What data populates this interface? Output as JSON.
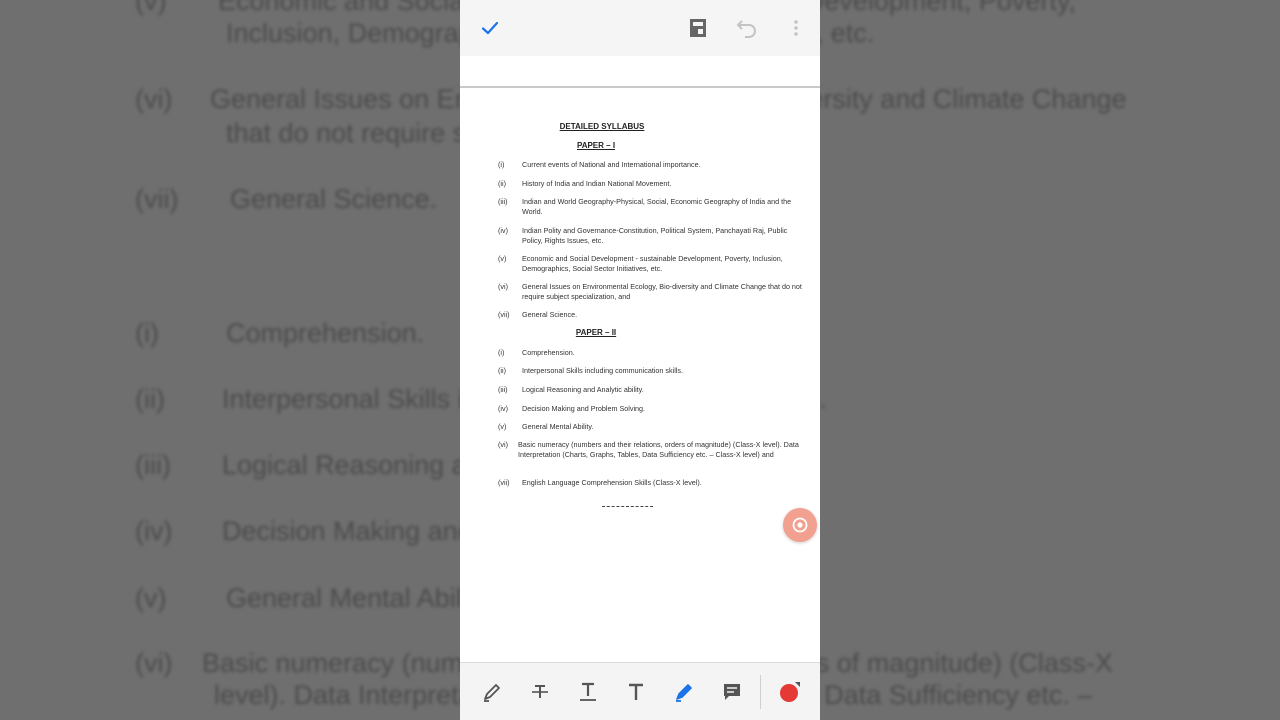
{
  "background_lines": [
    {
      "num": "(v)",
      "text": "Economic and Social Development - sustainable Development, Poverty,"
    },
    {
      "num": "",
      "text": "Inclusion, Demographics, Social Sector Initiatives, etc."
    },
    {
      "num": "(vi)",
      "text": "General Issues on Environmental Ecology, Bio-diversity and Climate Change"
    },
    {
      "num": "",
      "text": "that do not require subject specialization, and"
    },
    {
      "num": "(vii)",
      "text": "General Science."
    },
    {
      "num": "(i)",
      "text": "Comprehension."
    },
    {
      "num": "(ii)",
      "text": "Interpersonal Skills including communication skills."
    },
    {
      "num": "(iii)",
      "text": "Logical Reasoning and Analytic ability."
    },
    {
      "num": "(iv)",
      "text": "Decision Making and Problem Solving."
    },
    {
      "num": "(v)",
      "text": "General Mental Ability."
    },
    {
      "num": "(vi)",
      "text": "Basic numeracy (numbers and their relations, orders of magnitude) (Class-X"
    },
    {
      "num": "",
      "text": "level). Data Interpretation (Charts, Graphs, Tables, Data Sufficiency etc. –"
    }
  ],
  "document": {
    "title": "DETAILED SYLLABUS",
    "paper1": {
      "heading": "PAPER – I",
      "items": [
        {
          "num": "(i)",
          "text": "Current events of National and International importance."
        },
        {
          "num": "(ii)",
          "text": "History of India and Indian National Movement."
        },
        {
          "num": "(iii)",
          "text": "Indian and World Geography-Physical, Social, Economic Geography of India and the World."
        },
        {
          "num": "(iv)",
          "text": "Indian Polity and Governance-Constitution, Political System, Panchayati Raj, Public Policy, Rights Issues, etc."
        },
        {
          "num": "(v)",
          "text": "Economic and Social Development - sustainable Development, Poverty, Inclusion, Demographics, Social Sector Initiatives, etc."
        },
        {
          "num": "(vi)",
          "text": "General Issues on Environmental Ecology, Bio-diversity and Climate Change that do not require subject specialization, and"
        },
        {
          "num": "(vii)",
          "text": "General Science."
        }
      ]
    },
    "paper2": {
      "heading": "PAPER – II",
      "items": [
        {
          "num": "(i)",
          "text": "Comprehension."
        },
        {
          "num": "(ii)",
          "text": "Interpersonal Skills including communication skills."
        },
        {
          "num": "(iii)",
          "text": "Logical Reasoning and Analytic ability."
        },
        {
          "num": "(iv)",
          "text": "Decision Making and Problem Solving."
        },
        {
          "num": "(v)",
          "text": "General Mental Ability."
        },
        {
          "num": "(vi)",
          "text": "Basic numeracy (numbers and their relations, orders of magnitude) (Class-X level). Data Interpretation (Charts, Graphs, Tables, Data Sufficiency etc. – Class-X level) and"
        },
        {
          "num": "(vii)",
          "text": "English Language Comprehension Skills (Class-X level)."
        }
      ]
    }
  },
  "toolbar": {
    "tools": [
      "pen-icon",
      "strikethrough-icon",
      "underline-icon",
      "text-icon",
      "highlighter-icon",
      "comment-icon",
      "color-picker-icon"
    ]
  },
  "colors": {
    "accent": "#1a73e8",
    "fab": "#f2a08f",
    "record": "#e53935"
  }
}
